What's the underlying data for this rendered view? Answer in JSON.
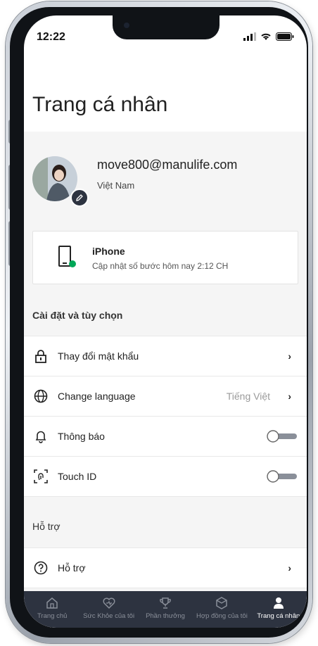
{
  "status_bar": {
    "time": "12:22"
  },
  "page_title": "Trang cá nhân",
  "profile": {
    "email": "move800@manulife.com",
    "country": "Việt Nam"
  },
  "device": {
    "name": "iPhone",
    "sync_text": "Cập nhật số bước hôm nay 2:12 CH",
    "status_color": "#00a758"
  },
  "settings": {
    "title": "Cài đặt và tùy chọn",
    "items": [
      {
        "icon": "lock-icon",
        "label": "Thay đổi mật khẩu"
      },
      {
        "icon": "globe-icon",
        "label": "Change language",
        "value": "Tiếng Việt"
      },
      {
        "icon": "bell-icon",
        "label": "Thông báo",
        "toggle_on": false
      },
      {
        "icon": "fingerprint-icon",
        "label": "Touch ID",
        "toggle_on": false
      }
    ]
  },
  "support": {
    "title": "Hỗ trợ",
    "items": [
      {
        "icon": "help-icon",
        "label": "Hỗ trợ"
      }
    ]
  },
  "tabs": [
    {
      "icon": "home-icon",
      "label": "Trang chủ",
      "active": false
    },
    {
      "icon": "health-icon",
      "label": "Sức Khỏe của tôi",
      "active": false
    },
    {
      "icon": "trophy-icon",
      "label": "Phần thưởng",
      "active": false
    },
    {
      "icon": "contract-icon",
      "label": "Hợp đồng của tôi",
      "active": false
    },
    {
      "icon": "person-icon",
      "label": "Trang cá nhân",
      "active": true
    }
  ],
  "colors": {
    "tabbar_bg": "#2d3340",
    "accent_green": "#00a758"
  }
}
